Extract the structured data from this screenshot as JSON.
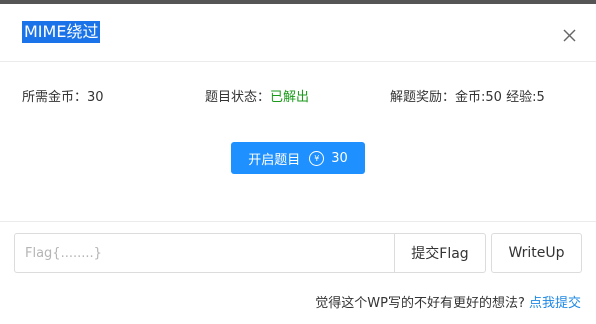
{
  "dialog": {
    "title": "MIME绕过",
    "close_icon": "close-icon"
  },
  "info": {
    "cost_label": "所需金币：",
    "cost_value": "30",
    "status_label": "题目状态：",
    "status_value": "已解出",
    "reward_label": "解题奖励：",
    "reward_value": "金币:50 经验:5"
  },
  "open_button": {
    "label": "开启题目",
    "coin_icon": "yen-coin-icon",
    "coin_symbol": "¥",
    "cost": "30"
  },
  "flag_form": {
    "placeholder": "Flag{........}",
    "value": "",
    "submit_label": "提交Flag",
    "writeup_label": "WriteUp"
  },
  "footer": {
    "question": "觉得这个WP写的不好有更好的想法?",
    "link_label": "点我提交"
  },
  "colors": {
    "accent": "#1e90ff",
    "solved": "#1a9a1a",
    "link": "#1e88e5",
    "title_highlight": "#1a73e8"
  }
}
